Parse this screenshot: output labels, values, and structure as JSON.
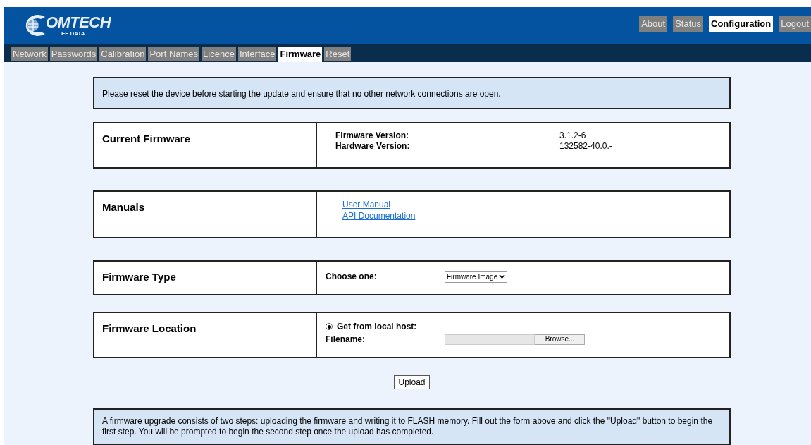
{
  "logo": {
    "text": "OMTECH",
    "subtext": "EF DATA"
  },
  "top_nav": [
    {
      "label": "About",
      "selected": false
    },
    {
      "label": "Status",
      "selected": false
    },
    {
      "label": "Configuration",
      "selected": true
    },
    {
      "label": "Logout",
      "selected": false
    }
  ],
  "tabs": [
    {
      "label": "Network",
      "selected": false
    },
    {
      "label": "Passwords",
      "selected": false
    },
    {
      "label": "Calibration",
      "selected": false
    },
    {
      "label": "Port Names",
      "selected": false
    },
    {
      "label": "Licence",
      "selected": false
    },
    {
      "label": "Interface",
      "selected": false
    },
    {
      "label": "Firmware",
      "selected": true
    },
    {
      "label": "Reset",
      "selected": false
    }
  ],
  "notice": "Please reset the device before starting the update and ensure that no other network connections are open.",
  "current_firmware": {
    "title": "Current Firmware",
    "rows": [
      {
        "label": "Firmware Version:",
        "value": "3.1.2-6"
      },
      {
        "label": "Hardware Version:",
        "value": "132582-40.0.-"
      }
    ]
  },
  "manuals": {
    "title": "Manuals",
    "links": [
      "User Manual",
      "API Documentation"
    ]
  },
  "firmware_type": {
    "title": "Firmware Type",
    "label": "Choose one:",
    "value": "Firmware Image"
  },
  "firmware_location": {
    "title": "Firmware Location",
    "option": {
      "label": "Get from local host:",
      "selected": true
    },
    "filename_label": "Filename:",
    "browse": "Browse..."
  },
  "upload_button": "Upload",
  "footer_note": "A firmware upgrade consists of two steps: uploading the firmware and writing it to FLASH memory. Fill out the form above and click the \"Upload\" button to begin the first step. You will be prompted to begin the second step once the upload has completed."
}
